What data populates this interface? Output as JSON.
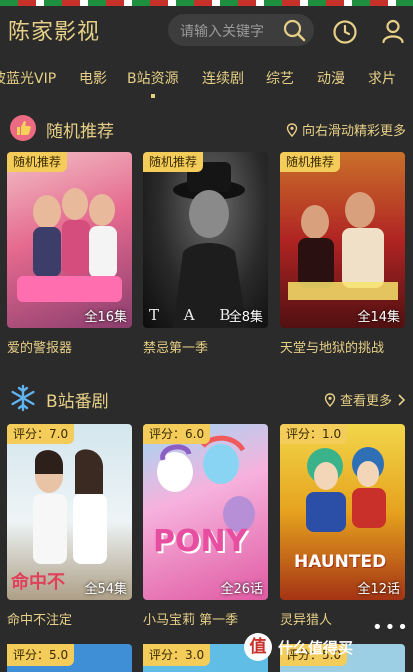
{
  "header": {
    "app_title": "陈家影视",
    "search_placeholder": "请输入关键字"
  },
  "nav": {
    "items": [
      "波蓝光VIP",
      "电影",
      "B站资源",
      "连续剧",
      "综艺",
      "动漫",
      "求片"
    ],
    "active_index": 2
  },
  "sections": [
    {
      "title": "随机推荐",
      "more": "向右滑动精彩更多",
      "cards": [
        {
          "tag": "随机推荐",
          "episodes": "全16集",
          "title": "爱的警报器",
          "poster_text": "",
          "colors": [
            "#e56a8f",
            "#8a3d6e",
            "#f2c0c6"
          ]
        },
        {
          "tag": "随机推荐",
          "episodes": "全8集",
          "title": "禁忌第一季",
          "poster_text": "T A B",
          "colors": [
            "#5b5b5b",
            "#1c1c1c",
            "#0c0c0c"
          ]
        },
        {
          "tag": "随机推荐",
          "episodes": "全14集",
          "title": "天堂与地狱的挑战",
          "poster_text": "",
          "colors": [
            "#b02423",
            "#511011",
            "#c9702a"
          ]
        }
      ]
    },
    {
      "title": "B站番剧",
      "more": "查看更多",
      "cards": [
        {
          "tag": "评分：7.0",
          "episodes": "全54集",
          "title": "命中不注定",
          "poster_text": "命中不",
          "colors": [
            "#d4e6ee",
            "#ffffff",
            "#ad9f86"
          ]
        },
        {
          "tag": "评分：6.0",
          "episodes": "全26话",
          "title": "小马宝莉 第一季",
          "poster_text": "PONY",
          "colors": [
            "#e05aa3",
            "#8d5fc4",
            "#f6b2dd"
          ]
        },
        {
          "tag": "评分：1.0",
          "episodes": "全12话",
          "title": "灵异猎人",
          "poster_text": "HAUNTED",
          "colors": [
            "#e6a21e",
            "#a43314",
            "#f2d64a"
          ]
        }
      ]
    }
  ],
  "row3_tags": [
    "评分：5.0",
    "评分：3.0",
    "评分：5.0"
  ],
  "more_dots": "•••",
  "watermark": {
    "logo": "值",
    "text": "什么值得买"
  }
}
